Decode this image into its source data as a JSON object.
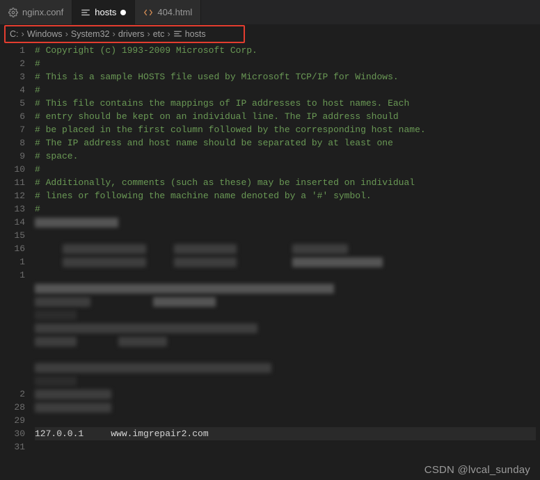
{
  "tabs": [
    {
      "label": "nginx.conf",
      "icon": "gear-icon",
      "active": false,
      "dirty": false
    },
    {
      "label": "hosts",
      "icon": "lines-icon",
      "active": true,
      "dirty": true
    },
    {
      "label": "404.html",
      "icon": "code-icon",
      "active": false,
      "dirty": false
    }
  ],
  "breadcrumb": {
    "segments": [
      "C:",
      "Windows",
      "System32",
      "drivers",
      "etc"
    ],
    "file": {
      "icon": "lines-icon",
      "name": "hosts"
    }
  },
  "code": {
    "lines": {
      "1": "# Copyright (c) 1993-2009 Microsoft Corp.",
      "2": "#",
      "3": "# This is a sample HOSTS file used by Microsoft TCP/IP for Windows.",
      "4": "#",
      "5": "# This file contains the mappings of IP addresses to host names. Each",
      "6": "# entry should be kept on an individual line. The IP address should",
      "7": "# be placed in the first column followed by the corresponding host name.",
      "8": "# The IP address and host name should be separated by at least one",
      "9": "# space.",
      "10": "#",
      "11": "# Additionally, comments (such as these) may be inserted on individual",
      "12": "# lines or following the machine name denoted by a '#' symbol.",
      "13": "#",
      "31": "127.0.0.1     www.imgrepair2.com"
    },
    "gutter": [
      "1",
      "2",
      "3",
      "4",
      "5",
      "6",
      "7",
      "8",
      "9",
      "10",
      "11",
      "12",
      "13",
      "14",
      "15",
      "16",
      "1",
      "1",
      "",
      "",
      "",
      "",
      "",
      "",
      "",
      "",
      "2",
      "28",
      "29",
      "30",
      "31"
    ]
  },
  "watermark": "CSDN @lvcal_sunday"
}
